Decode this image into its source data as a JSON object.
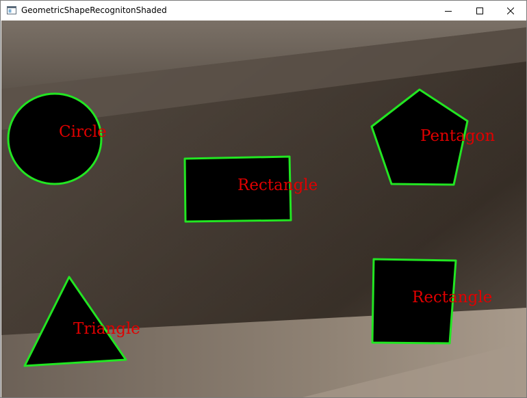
{
  "window": {
    "title": "GeometricShapeRecognitonShaded",
    "icon": "app-window-icon",
    "controls": [
      "minimize-icon",
      "maximize-icon",
      "close-icon"
    ]
  },
  "colors": {
    "contour": "#22e622",
    "label": "#e00000",
    "shape_fill": "#000000"
  },
  "shapes": [
    {
      "type": "circle",
      "label": "Circle"
    },
    {
      "type": "rectangle",
      "label": "Rectangle"
    },
    {
      "type": "pentagon",
      "label": "Pentagon"
    },
    {
      "type": "triangle",
      "label": "Triangle"
    },
    {
      "type": "rectangle",
      "label": "Rectangle"
    }
  ]
}
